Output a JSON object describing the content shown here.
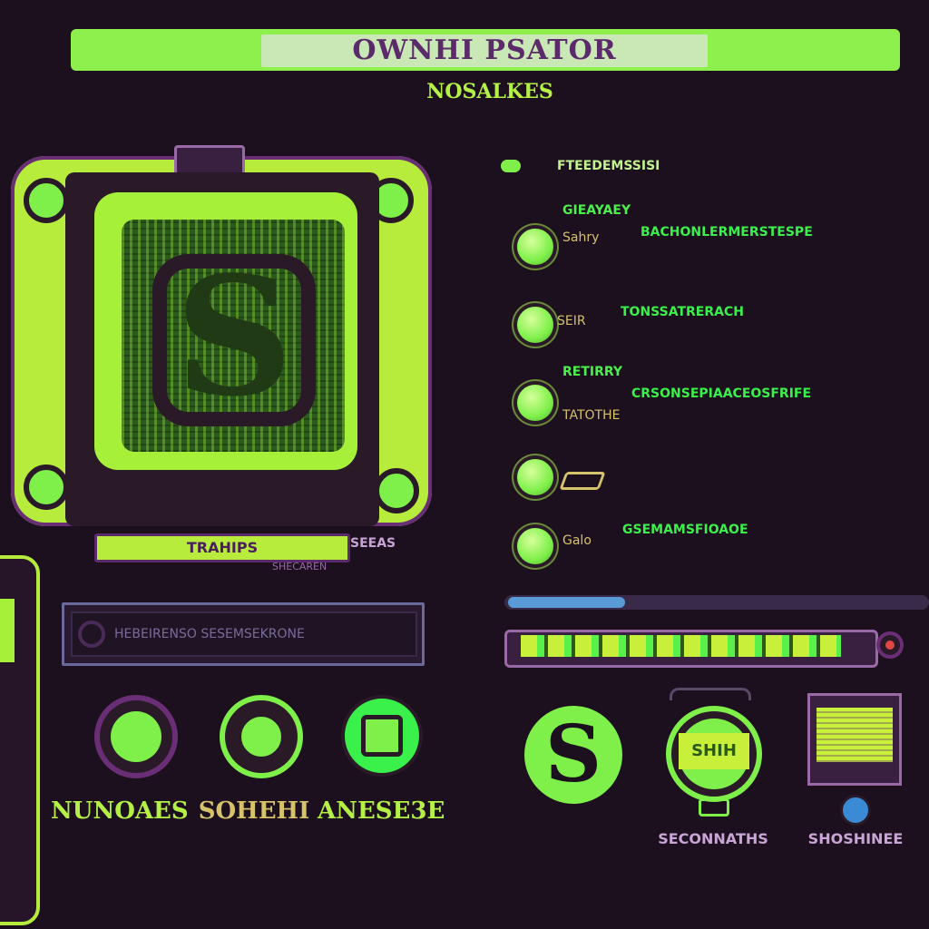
{
  "header": {
    "title": "OWNHI PSATOR",
    "subtitle": "NOSALKES"
  },
  "device": {
    "status_label": "TRAHIPS",
    "status_side": "SEEAS",
    "sub_label": "SHECAREN"
  },
  "search": {
    "placeholder": "HEBEIRENSO SESEMSEKRONE"
  },
  "settings_list": {
    "header": "FTEEDEMSSISI",
    "items": [
      {
        "title": "GIEAYAEY",
        "label": "Sahry",
        "value": "BACHONLERMERSTESPE"
      },
      {
        "title": "",
        "label": "SEIR",
        "value": "TONSSATRERACH"
      },
      {
        "title": "RETIRRY",
        "label": "TATOTHE",
        "value": "CRSONSEPIAACEOSFRIFE"
      },
      {
        "title": "",
        "label": "",
        "value": ""
      },
      {
        "title": "",
        "label": "Galo",
        "value": "GSEMAMSFIOAOE"
      }
    ]
  },
  "progress": {
    "slider_level": 0.28,
    "fill_level": 0.92
  },
  "buttons": [
    {
      "label": "NUNOAES",
      "color": "#b4f046"
    },
    {
      "label": "SOHEHI",
      "color": "#d6c26a"
    },
    {
      "label": "ANESE3E",
      "color": "#b4f046"
    }
  ],
  "apps": {
    "s_icon_glyph": "S",
    "circle_label": "SHIH",
    "circle_caption": "SECONNATHS",
    "window_caption": "SHOSHINEE"
  },
  "colors": {
    "accent": "#7ff04a",
    "lime": "#b7ec3c",
    "purple": "#6a2e76",
    "background": "#1c0f1e"
  }
}
